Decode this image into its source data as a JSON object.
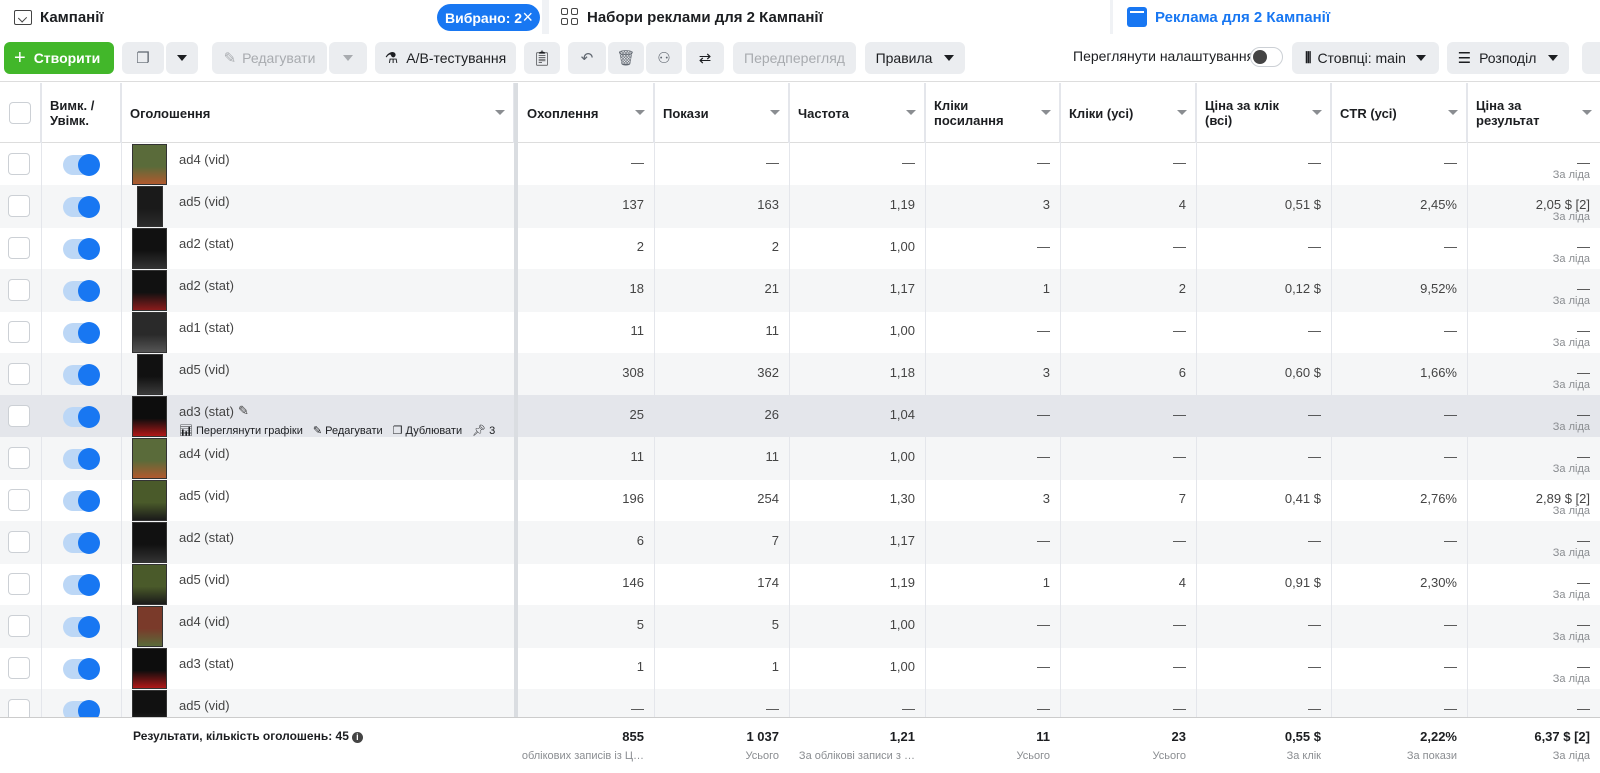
{
  "tabs": {
    "campaigns": "Кампанії",
    "selected": "Вибрано: 2",
    "adsets": "Набори реклами для 2 Кампанії",
    "ads": "Реклама для 2 Кампанії"
  },
  "toolbar": {
    "create": "Створити",
    "edit": "Редагувати",
    "ab_test": "A/B-тестування",
    "preview": "Передперегляд",
    "rules": "Правила",
    "view_settings": "Переглянути налаштування",
    "columns": "Стовпці: main",
    "breakdown": "Розподіл"
  },
  "columns": {
    "toggle": "Вимк. / Увімк.",
    "ad": "Оголошення",
    "reach": "Охоплення",
    "impressions": "Покази",
    "frequency": "Частота",
    "link_clicks": "Кліки посилання",
    "clicks_all": "Кліки (усі)",
    "cpc_all": "Ціна за клік (всі)",
    "ctr_all": "CTR (усі)",
    "cost_per_result": "Ціна за результат"
  },
  "rows": [
    {
      "name": "ad4 (vid)",
      "reach": "—",
      "impr": "—",
      "freq": "—",
      "link": "—",
      "clicks": "—",
      "cpc": "—",
      "ctr": "—",
      "cpr": "—",
      "cpr_sub": "За ліда"
    },
    {
      "name": "ad5 (vid)",
      "reach": "137",
      "impr": "163",
      "freq": "1,19",
      "link": "3",
      "clicks": "4",
      "cpc": "0,51 $",
      "ctr": "2,45%",
      "cpr": "2,05 $ [2]",
      "cpr_sub": "За ліда"
    },
    {
      "name": "ad2 (stat)",
      "reach": "2",
      "impr": "2",
      "freq": "1,00",
      "link": "—",
      "clicks": "—",
      "cpc": "—",
      "ctr": "—",
      "cpr": "—",
      "cpr_sub": "За ліда"
    },
    {
      "name": "ad2 (stat)",
      "reach": "18",
      "impr": "21",
      "freq": "1,17",
      "link": "1",
      "clicks": "2",
      "cpc": "0,12 $",
      "ctr": "9,52%",
      "cpr": "—",
      "cpr_sub": "За ліда"
    },
    {
      "name": "ad1 (stat)",
      "reach": "11",
      "impr": "11",
      "freq": "1,00",
      "link": "—",
      "clicks": "—",
      "cpc": "—",
      "ctr": "—",
      "cpr": "—",
      "cpr_sub": "За ліда"
    },
    {
      "name": "ad5 (vid)",
      "reach": "308",
      "impr": "362",
      "freq": "1,18",
      "link": "3",
      "clicks": "6",
      "cpc": "0,60 $",
      "ctr": "1,66%",
      "cpr": "—",
      "cpr_sub": "За ліда"
    },
    {
      "name": "ad3 (stat)",
      "reach": "25",
      "impr": "26",
      "freq": "1,04",
      "link": "—",
      "clicks": "—",
      "cpc": "—",
      "ctr": "—",
      "cpr": "—",
      "cpr_sub": "За ліда"
    },
    {
      "name": "ad4 (vid)",
      "reach": "11",
      "impr": "11",
      "freq": "1,00",
      "link": "—",
      "clicks": "—",
      "cpc": "—",
      "ctr": "—",
      "cpr": "—",
      "cpr_sub": "За ліда"
    },
    {
      "name": "ad5 (vid)",
      "reach": "196",
      "impr": "254",
      "freq": "1,30",
      "link": "3",
      "clicks": "7",
      "cpc": "0,41 $",
      "ctr": "2,76%",
      "cpr": "2,89 $ [2]",
      "cpr_sub": "За ліда"
    },
    {
      "name": "ad2 (stat)",
      "reach": "6",
      "impr": "7",
      "freq": "1,17",
      "link": "—",
      "clicks": "—",
      "cpc": "—",
      "ctr": "—",
      "cpr": "—",
      "cpr_sub": "За ліда"
    },
    {
      "name": "ad5 (vid)",
      "reach": "146",
      "impr": "174",
      "freq": "1,19",
      "link": "1",
      "clicks": "4",
      "cpc": "0,91 $",
      "ctr": "2,30%",
      "cpr": "—",
      "cpr_sub": "За ліда"
    },
    {
      "name": "ad4 (vid)",
      "reach": "5",
      "impr": "5",
      "freq": "1,00",
      "link": "—",
      "clicks": "—",
      "cpc": "—",
      "ctr": "—",
      "cpr": "—",
      "cpr_sub": "За ліда"
    },
    {
      "name": "ad3 (stat)",
      "reach": "1",
      "impr": "1",
      "freq": "1,00",
      "link": "—",
      "clicks": "—",
      "cpc": "—",
      "ctr": "—",
      "cpr": "—",
      "cpr_sub": "За ліда"
    },
    {
      "name": "ad5 (vid)",
      "reach": "—",
      "impr": "—",
      "freq": "—",
      "link": "—",
      "clicks": "—",
      "cpc": "—",
      "ctr": "—",
      "cpr": "—",
      "cpr_sub": ""
    }
  ],
  "row_actions": {
    "charts": "Переглянути графіки",
    "edit": "Редагувати",
    "duplicate": "Дублювати",
    "pin": "3"
  },
  "totals": {
    "label": "Результати, кількість оголошень: 45",
    "reach": "855",
    "reach_sub": "облікових записів із Ц…",
    "impr": "1 037",
    "impr_sub": "Усього",
    "freq": "1,21",
    "freq_sub": "За облікові записи з …",
    "link": "11",
    "link_sub": "Усього",
    "clicks": "23",
    "clicks_sub": "Усього",
    "cpc": "0,55 $",
    "cpc_sub": "За клік",
    "ctr": "2,22%",
    "ctr_sub": "За покази",
    "cpr": "6,37 $ [2]",
    "cpr_sub": "За ліда"
  },
  "colors": {
    "accent": "#1877f2",
    "create": "#42b72a"
  }
}
